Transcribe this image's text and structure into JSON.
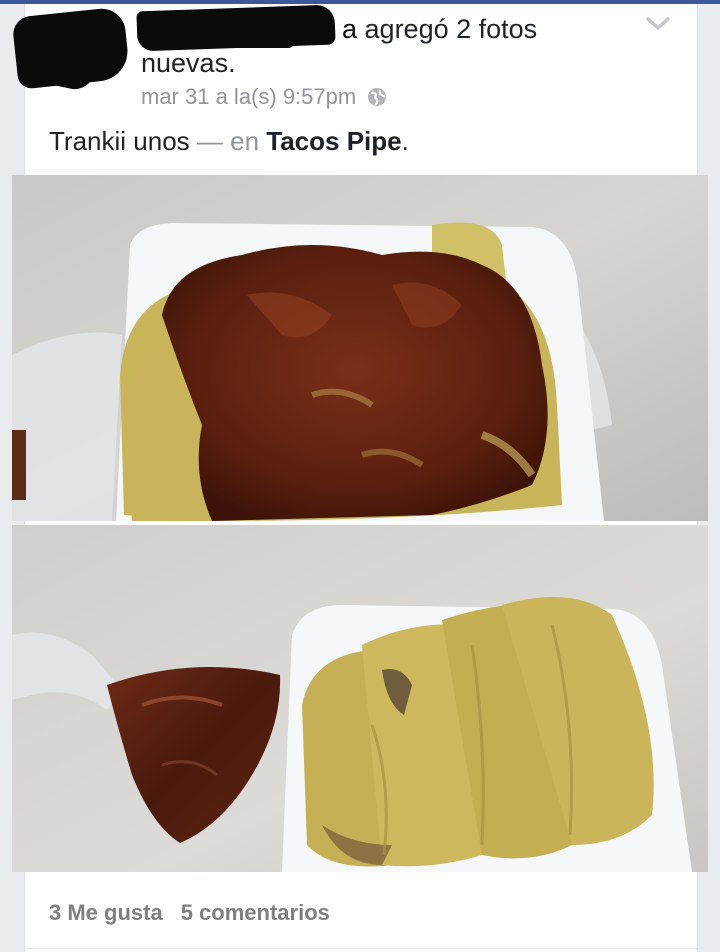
{
  "post": {
    "actor_visible_fragment": "a",
    "action_text": " agregó 2 fotos nuevas.",
    "timestamp": "mar 31 a la(s) 9:57pm",
    "privacy_icon": "globe-icon",
    "status_text": "Trankii unos",
    "status_separator": " — en ",
    "place_name": "Tacos Pipe",
    "status_end": "."
  },
  "photos": [
    {
      "name": "photo-tacos-with-salsa"
    },
    {
      "name": "photo-tacos-and-salsa-bag"
    }
  ],
  "engagement": {
    "likes": "3 Me gusta",
    "comments": "5 comentarios"
  },
  "colors": {
    "accent": "#3b5998",
    "muted_text": "#90949c",
    "body_text": "#1d2129"
  }
}
